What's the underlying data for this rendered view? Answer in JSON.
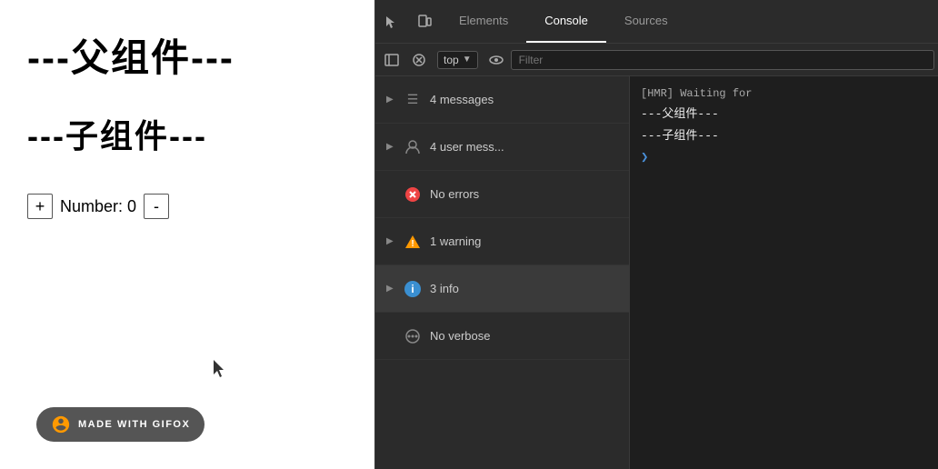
{
  "left": {
    "parent_label": "---父组件---",
    "child_label": "---子组件---",
    "counter_label": "Number: 0",
    "plus_btn": "+",
    "minus_btn": "-",
    "gifox_text": "MADE WITH GIFOX"
  },
  "devtools": {
    "tabs": [
      {
        "label": "Elements",
        "active": false
      },
      {
        "label": "Console",
        "active": true
      },
      {
        "label": "Sources",
        "active": false
      }
    ],
    "toolbar": {
      "level": "top",
      "filter_placeholder": "Filter"
    },
    "sidebar": {
      "items": [
        {
          "icon": "list-icon",
          "label": "4 messages",
          "has_arrow": true,
          "selected": false
        },
        {
          "icon": "user-icon",
          "label": "4 user mess...",
          "has_arrow": true,
          "selected": false
        },
        {
          "icon": "error-icon",
          "label": "No errors",
          "has_arrow": false,
          "selected": false
        },
        {
          "icon": "warning-icon",
          "label": "1 warning",
          "has_arrow": true,
          "selected": false
        },
        {
          "icon": "info-icon",
          "label": "3 info",
          "has_arrow": true,
          "selected": true
        },
        {
          "icon": "verbose-icon",
          "label": "No verbose",
          "has_arrow": false,
          "selected": false
        }
      ]
    },
    "output": {
      "lines": [
        {
          "text": "[HMR] Waiting for",
          "type": "hmr"
        },
        {
          "text": "---父组件---",
          "type": "component"
        },
        {
          "text": "---子组件---",
          "type": "component"
        }
      ]
    }
  }
}
